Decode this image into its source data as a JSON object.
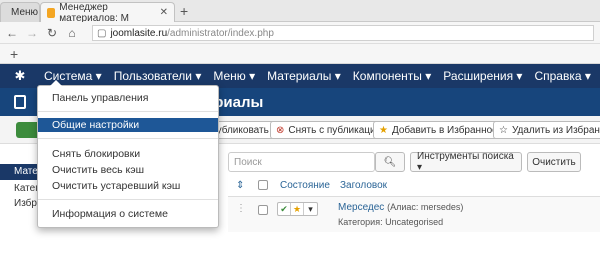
{
  "browser": {
    "tab1": {
      "label": "Меню"
    },
    "tab2": {
      "label": "Менеджер материалов: M"
    },
    "url_host": "joomlasite.ru",
    "url_path": "/administrator/index.php"
  },
  "menubar": {
    "items": [
      "Система ▾",
      "Пользователи ▾",
      "Меню ▾",
      "Материалы ▾",
      "Компоненты ▾",
      "Расширения ▾",
      "Справка ▾"
    ]
  },
  "page": {
    "title": "ов: Материалы"
  },
  "toolbar": {
    "buttons": [
      {
        "label": "Опубликовать",
        "icon": "✔"
      },
      {
        "label": "Снять с публикации",
        "icon": "⊗"
      },
      {
        "label": "Добавить в Избранное",
        "icon": "★"
      },
      {
        "label": "Удалить из Избранного",
        "icon": "☆"
      }
    ]
  },
  "sidebar": {
    "items": [
      "Мате",
      "Катег",
      "Избра"
    ]
  },
  "search": {
    "placeholder": "Поиск",
    "tools_label": "Инструменты поиска ▾",
    "clear_label": "Очистить"
  },
  "table": {
    "headers": {
      "status": "Состояние",
      "title": "Заголовок"
    },
    "rows": [
      {
        "title": "Мерседес",
        "alias": "(Алиас: mersedes)",
        "category": "Категория: Uncategorised"
      }
    ]
  },
  "dropdown": {
    "items": [
      "Панель управления",
      "Общие настройки",
      "Снять блокировки",
      "Очистить весь кэш",
      "Очистить устаревший кэш",
      "Информация о системе"
    ],
    "active_index": 1
  },
  "colors": {
    "navbar": "#1a3867",
    "subhead": "#17457c",
    "highlight": "#1e5797",
    "link": "#2a6496"
  }
}
